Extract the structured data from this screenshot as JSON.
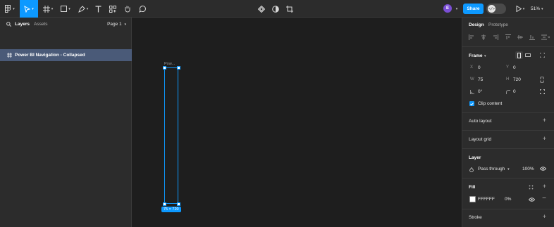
{
  "toolbar": {
    "avatar_initial": "E",
    "share_label": "Share",
    "devmode_label": "</>",
    "zoom_label": "51%"
  },
  "left_panel": {
    "tab_layers": "Layers",
    "tab_assets": "Assets",
    "page_selector": "Page 1",
    "layers": [
      {
        "label": "Power BI Navigation - Collapsed",
        "selected": true
      }
    ]
  },
  "canvas": {
    "frame_label": "Pow...",
    "dimension_badge": "75 × 720"
  },
  "right_panel": {
    "tab_design": "Design",
    "tab_prototype": "Prototype",
    "frame": {
      "title": "Frame",
      "x_label": "X",
      "x_value": "0",
      "y_label": "Y",
      "y_value": "0",
      "w_label": "W",
      "w_value": "75",
      "h_label": "H",
      "h_value": "720",
      "rotation_value": "0°",
      "radius_value": "0",
      "clip_content_label": "Clip content"
    },
    "auto_layout": "Auto layout",
    "layout_grid": "Layout grid",
    "layer": {
      "title": "Layer",
      "blend_mode": "Pass through",
      "opacity": "100%"
    },
    "fill": {
      "title": "Fill",
      "hex": "FFFFFF",
      "opacity": "0%"
    },
    "stroke": "Stroke"
  },
  "colors": {
    "accent": "#0d99ff",
    "selected_layer_bg": "#4a5a78",
    "panel_bg": "#2c2c2c",
    "canvas_bg": "#1e1e1e",
    "avatar_bg": "#7b4fd6"
  }
}
